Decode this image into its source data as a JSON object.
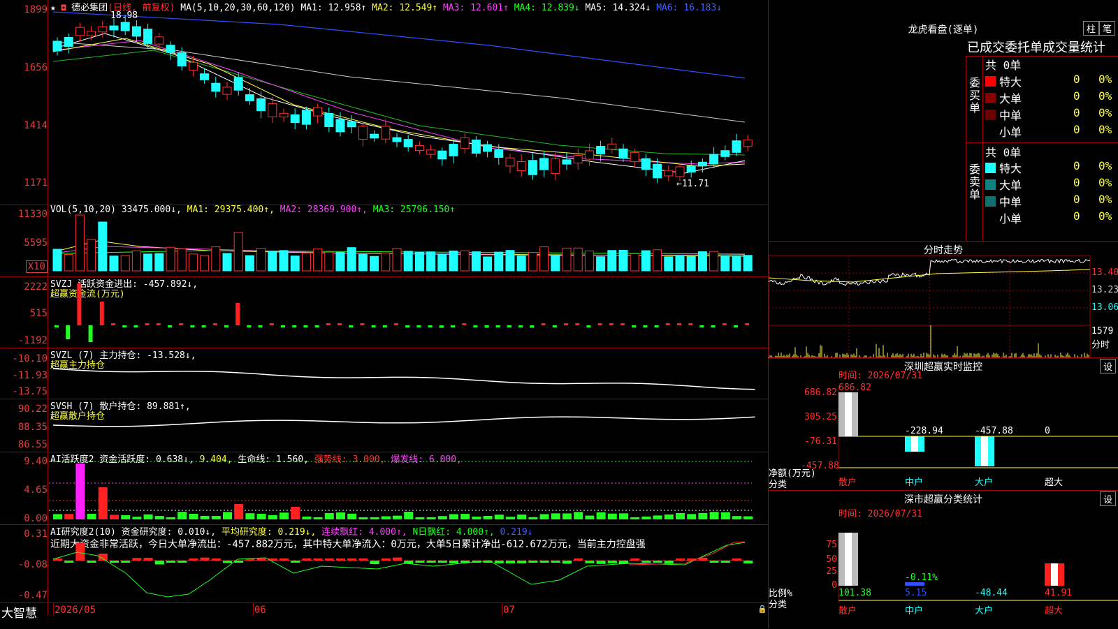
{
  "title": {
    "star": "★",
    "name": "德必集团",
    "period": "(日线, 前复权)"
  },
  "ma_legend": [
    {
      "label": "MA(5,10,20,30,60,120)",
      "color": "#ffffff"
    },
    {
      "label": "MA1: 12.958↑",
      "color": "#ffffff"
    },
    {
      "label": "MA2: 12.549↑",
      "color": "#ffff40"
    },
    {
      "label": "MA3: 12.601↑",
      "color": "#ff40ff"
    },
    {
      "label": "MA4: 12.839↓",
      "color": "#20ff20"
    },
    {
      "label": "MA5: 14.324↓",
      "color": "#ffffff"
    },
    {
      "label": "MA6: 16.183↓",
      "color": "#4060ff"
    }
  ],
  "price_axis": [
    "1899",
    "1656",
    "1414",
    "1171"
  ],
  "price_marks": {
    "high": "18.98",
    "low": "←11.71"
  },
  "vol": {
    "legend": [
      {
        "label": "VOL(5,10,20)",
        "color": "#ffffff"
      },
      {
        "label": "33475.000↓,",
        "color": "#ffffff"
      },
      {
        "label": "MA1: 29375.400↑,",
        "color": "#ffff40"
      },
      {
        "label": "MA2: 28369.900↑,",
        "color": "#ff40ff"
      },
      {
        "label": "MA3: 25796.150↑",
        "color": "#20ff20"
      }
    ],
    "axis": [
      "11330",
      "5595",
      "X10"
    ]
  },
  "svzj": {
    "legend": [
      {
        "label": "SVZJ  活跃资金进出: -457.892↓,",
        "color": "#ffffff"
      }
    ],
    "sub": "超赢资金流(万元)",
    "axis": [
      "2222",
      "515",
      "-1192"
    ]
  },
  "svzl": {
    "legend": [
      {
        "label": "SVZL (7) 主力持仓: -13.528↓,",
        "color": "#ffffff"
      }
    ],
    "sub": "超赢主力持仓",
    "axis": [
      "-10.10",
      "-11.93",
      "-13.75"
    ]
  },
  "svsh": {
    "legend": [
      {
        "label": "SVSH (7) 散户持仓: 89.881↑,",
        "color": "#ffffff"
      }
    ],
    "sub": "超赢散户持仓",
    "axis": [
      "90.22",
      "88.35",
      "86.55"
    ]
  },
  "ai1": {
    "legend": [
      {
        "label": "AI活跃度2 资金活跃度: 0.638↓,",
        "color": "#ffffff"
      },
      {
        "label": "9.404,",
        "color": "#ffff40"
      },
      {
        "label": "生命线: 1.560,",
        "color": "#ffffff"
      },
      {
        "label": "强势线: 3.000,",
        "color": "#ff3030"
      },
      {
        "label": "爆发线: 6.000,",
        "color": "#ff40ff"
      }
    ],
    "axis": [
      "9.40",
      "4.65",
      "0.00"
    ]
  },
  "ai2": {
    "legend": [
      {
        "label": "AI研究度2(10) 资金研究度: 0.010↓,",
        "color": "#ffffff"
      },
      {
        "label": "平均研究度: 0.219↓,",
        "color": "#ffff40"
      },
      {
        "label": "连续飘红: 4.000↑,",
        "color": "#ff40ff"
      },
      {
        "label": "N日飘红: 4.000↑,",
        "color": "#20ff20"
      },
      {
        "label": "0.219↓",
        "color": "#4060ff"
      }
    ],
    "note": "近期大资金非常活跃，今日大单净流出：-457.882万元，其中特大单净流入：0万元，大单5日累计净出-612.672万元，当前主力控盘强",
    "axis": [
      "0.31",
      "-0.08",
      "-0.47"
    ]
  },
  "bottom": {
    "brand": "大智慧",
    "dates": [
      "2026/05",
      "06",
      "07"
    ]
  },
  "longhu": {
    "title": "龙虎看盘(逐单)",
    "btn1": "柱",
    "btn2": "笔",
    "header": "已成交委托单成交量统计",
    "buy_label": "委买单",
    "sell_label": "委卖单",
    "buy_total": "共 0单",
    "sell_total": "共 0单",
    "buy_rows": [
      {
        "name": "特大",
        "count": "0",
        "pct": "0%",
        "color": "#ff0000"
      },
      {
        "name": "大单",
        "count": "0",
        "pct": "0%",
        "color": "#8a0000"
      },
      {
        "name": "中单",
        "count": "0",
        "pct": "0%",
        "color": "#6a0000"
      },
      {
        "name": "小单",
        "count": "0",
        "pct": "0%",
        "color": "#000000"
      }
    ],
    "sell_rows": [
      {
        "name": "特大",
        "count": "0",
        "pct": "0%",
        "color": "#20ffff"
      },
      {
        "name": "大单",
        "count": "0",
        "pct": "0%",
        "color": "#108080"
      },
      {
        "name": "中单",
        "count": "0",
        "pct": "0%",
        "color": "#107070"
      },
      {
        "name": "小单",
        "count": "0",
        "pct": "0%",
        "color": "#000000"
      }
    ]
  },
  "intraday": {
    "title": "分时走势",
    "axis": [
      "13.40",
      "13.23",
      "13.06"
    ],
    "vol_top": "1579",
    "vol_label": "分时"
  },
  "monitor": {
    "title": "深圳超赢实时监控",
    "btn": "设",
    "time": "时间: 2026/07/31",
    "axis": [
      "686.82",
      "305.25",
      "-76.31",
      "-457.88"
    ],
    "ylabel": "净额(万元)",
    "xlabel": "分类",
    "bars": [
      {
        "cat": "散户",
        "value": "686.82"
      },
      {
        "cat": "中户",
        "value": "-228.94"
      },
      {
        "cat": "大户",
        "value": "-457.88"
      },
      {
        "cat": "超大",
        "value": "0"
      }
    ]
  },
  "classify": {
    "title": "深市超赢分类统计",
    "btn": "设",
    "time": "时间: 2026/07/31",
    "axis": [
      "75",
      "50",
      "25",
      "0"
    ],
    "ylabel": "比例%",
    "xlabel": "分类",
    "bars": [
      {
        "cat": "散户",
        "value": "101.38",
        "inner": ""
      },
      {
        "cat": "中户",
        "value": "5.15",
        "inner": "-0.11%"
      },
      {
        "cat": "大户",
        "value": "-48.44",
        "inner": ""
      },
      {
        "cat": "超大",
        "value": "41.91",
        "inner": ""
      }
    ]
  }
}
